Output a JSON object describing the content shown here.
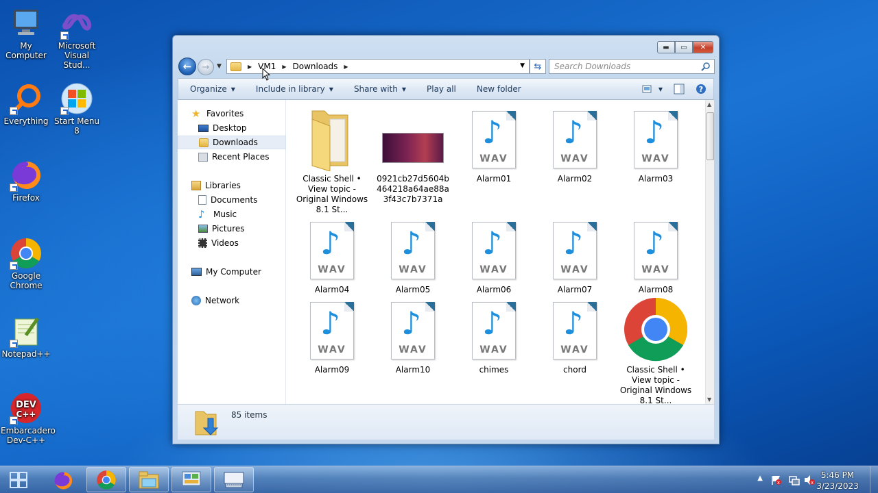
{
  "desktop": {
    "icons": [
      {
        "label": "My Computer"
      },
      {
        "label": "Microsoft Visual Stud..."
      },
      {
        "label": "Everything"
      },
      {
        "label": "Start Menu 8"
      },
      {
        "label": "Firefox"
      },
      {
        "label": "Google Chrome"
      },
      {
        "label": "Notepad++"
      },
      {
        "label": "Embarcadero Dev-C++"
      }
    ]
  },
  "window": {
    "breadcrumb": [
      "VM1",
      "Downloads"
    ],
    "search_placeholder": "Search Downloads",
    "toolbar": {
      "organize": "Organize",
      "include_in_library": "Include in library",
      "share_with": "Share with",
      "play_all": "Play all",
      "new_folder": "New folder"
    },
    "navpane": {
      "favorites": "Favorites",
      "desktop": "Desktop",
      "downloads": "Downloads",
      "recent_places": "Recent Places",
      "libraries": "Libraries",
      "documents": "Documents",
      "music": "Music",
      "pictures": "Pictures",
      "videos": "Videos",
      "my_computer": "My Computer",
      "network": "Network"
    },
    "files": [
      {
        "name": "Classic Shell • View topic - Original Windows 8.1 St...",
        "type": "folder"
      },
      {
        "name": "0921cb27d5604b464218a64ae88a3f43c7b7371a",
        "type": "image"
      },
      {
        "name": "Alarm01",
        "type": "wav"
      },
      {
        "name": "Alarm02",
        "type": "wav"
      },
      {
        "name": "Alarm03",
        "type": "wav"
      },
      {
        "name": "Alarm04",
        "type": "wav"
      },
      {
        "name": "Alarm05",
        "type": "wav"
      },
      {
        "name": "Alarm06",
        "type": "wav"
      },
      {
        "name": "Alarm07",
        "type": "wav"
      },
      {
        "name": "Alarm08",
        "type": "wav"
      },
      {
        "name": "Alarm09",
        "type": "wav"
      },
      {
        "name": "Alarm10",
        "type": "wav"
      },
      {
        "name": "chimes",
        "type": "wav"
      },
      {
        "name": "chord",
        "type": "wav"
      },
      {
        "name": "Classic Shell • View topic - Original Windows 8.1 St...",
        "type": "chrome"
      }
    ],
    "wav_badge": "WAV",
    "details": {
      "item_count": "85 items"
    }
  },
  "taskbar": {
    "clock_time": "5:46 PM",
    "clock_date": "3/23/2023"
  },
  "colors": {
    "accent": "#1e5fb4",
    "close": "#c4412b",
    "wav_note": "#1d8fdc"
  }
}
